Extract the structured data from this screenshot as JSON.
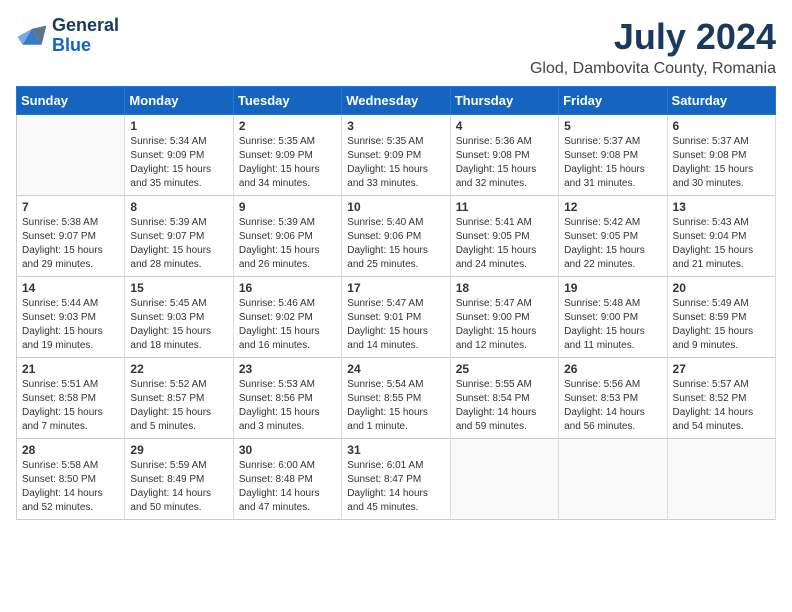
{
  "header": {
    "logo_general": "General",
    "logo_blue": "Blue",
    "month": "July 2024",
    "location": "Glod, Dambovita County, Romania"
  },
  "days_of_week": [
    "Sunday",
    "Monday",
    "Tuesday",
    "Wednesday",
    "Thursday",
    "Friday",
    "Saturday"
  ],
  "weeks": [
    [
      {
        "num": "",
        "detail": ""
      },
      {
        "num": "1",
        "detail": "Sunrise: 5:34 AM\nSunset: 9:09 PM\nDaylight: 15 hours\nand 35 minutes."
      },
      {
        "num": "2",
        "detail": "Sunrise: 5:35 AM\nSunset: 9:09 PM\nDaylight: 15 hours\nand 34 minutes."
      },
      {
        "num": "3",
        "detail": "Sunrise: 5:35 AM\nSunset: 9:09 PM\nDaylight: 15 hours\nand 33 minutes."
      },
      {
        "num": "4",
        "detail": "Sunrise: 5:36 AM\nSunset: 9:08 PM\nDaylight: 15 hours\nand 32 minutes."
      },
      {
        "num": "5",
        "detail": "Sunrise: 5:37 AM\nSunset: 9:08 PM\nDaylight: 15 hours\nand 31 minutes."
      },
      {
        "num": "6",
        "detail": "Sunrise: 5:37 AM\nSunset: 9:08 PM\nDaylight: 15 hours\nand 30 minutes."
      }
    ],
    [
      {
        "num": "7",
        "detail": "Sunrise: 5:38 AM\nSunset: 9:07 PM\nDaylight: 15 hours\nand 29 minutes."
      },
      {
        "num": "8",
        "detail": "Sunrise: 5:39 AM\nSunset: 9:07 PM\nDaylight: 15 hours\nand 28 minutes."
      },
      {
        "num": "9",
        "detail": "Sunrise: 5:39 AM\nSunset: 9:06 PM\nDaylight: 15 hours\nand 26 minutes."
      },
      {
        "num": "10",
        "detail": "Sunrise: 5:40 AM\nSunset: 9:06 PM\nDaylight: 15 hours\nand 25 minutes."
      },
      {
        "num": "11",
        "detail": "Sunrise: 5:41 AM\nSunset: 9:05 PM\nDaylight: 15 hours\nand 24 minutes."
      },
      {
        "num": "12",
        "detail": "Sunrise: 5:42 AM\nSunset: 9:05 PM\nDaylight: 15 hours\nand 22 minutes."
      },
      {
        "num": "13",
        "detail": "Sunrise: 5:43 AM\nSunset: 9:04 PM\nDaylight: 15 hours\nand 21 minutes."
      }
    ],
    [
      {
        "num": "14",
        "detail": "Sunrise: 5:44 AM\nSunset: 9:03 PM\nDaylight: 15 hours\nand 19 minutes."
      },
      {
        "num": "15",
        "detail": "Sunrise: 5:45 AM\nSunset: 9:03 PM\nDaylight: 15 hours\nand 18 minutes."
      },
      {
        "num": "16",
        "detail": "Sunrise: 5:46 AM\nSunset: 9:02 PM\nDaylight: 15 hours\nand 16 minutes."
      },
      {
        "num": "17",
        "detail": "Sunrise: 5:47 AM\nSunset: 9:01 PM\nDaylight: 15 hours\nand 14 minutes."
      },
      {
        "num": "18",
        "detail": "Sunrise: 5:47 AM\nSunset: 9:00 PM\nDaylight: 15 hours\nand 12 minutes."
      },
      {
        "num": "19",
        "detail": "Sunrise: 5:48 AM\nSunset: 9:00 PM\nDaylight: 15 hours\nand 11 minutes."
      },
      {
        "num": "20",
        "detail": "Sunrise: 5:49 AM\nSunset: 8:59 PM\nDaylight: 15 hours\nand 9 minutes."
      }
    ],
    [
      {
        "num": "21",
        "detail": "Sunrise: 5:51 AM\nSunset: 8:58 PM\nDaylight: 15 hours\nand 7 minutes."
      },
      {
        "num": "22",
        "detail": "Sunrise: 5:52 AM\nSunset: 8:57 PM\nDaylight: 15 hours\nand 5 minutes."
      },
      {
        "num": "23",
        "detail": "Sunrise: 5:53 AM\nSunset: 8:56 PM\nDaylight: 15 hours\nand 3 minutes."
      },
      {
        "num": "24",
        "detail": "Sunrise: 5:54 AM\nSunset: 8:55 PM\nDaylight: 15 hours\nand 1 minute."
      },
      {
        "num": "25",
        "detail": "Sunrise: 5:55 AM\nSunset: 8:54 PM\nDaylight: 14 hours\nand 59 minutes."
      },
      {
        "num": "26",
        "detail": "Sunrise: 5:56 AM\nSunset: 8:53 PM\nDaylight: 14 hours\nand 56 minutes."
      },
      {
        "num": "27",
        "detail": "Sunrise: 5:57 AM\nSunset: 8:52 PM\nDaylight: 14 hours\nand 54 minutes."
      }
    ],
    [
      {
        "num": "28",
        "detail": "Sunrise: 5:58 AM\nSunset: 8:50 PM\nDaylight: 14 hours\nand 52 minutes."
      },
      {
        "num": "29",
        "detail": "Sunrise: 5:59 AM\nSunset: 8:49 PM\nDaylight: 14 hours\nand 50 minutes."
      },
      {
        "num": "30",
        "detail": "Sunrise: 6:00 AM\nSunset: 8:48 PM\nDaylight: 14 hours\nand 47 minutes."
      },
      {
        "num": "31",
        "detail": "Sunrise: 6:01 AM\nSunset: 8:47 PM\nDaylight: 14 hours\nand 45 minutes."
      },
      {
        "num": "",
        "detail": ""
      },
      {
        "num": "",
        "detail": ""
      },
      {
        "num": "",
        "detail": ""
      }
    ]
  ]
}
